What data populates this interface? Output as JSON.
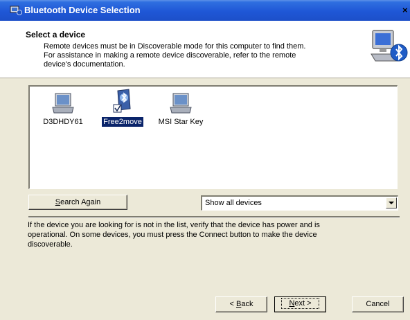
{
  "window": {
    "title": "Bluetooth Device Selection",
    "close_glyph": "×"
  },
  "header": {
    "title": "Select a device",
    "description_lines": [
      "Remote devices must be in Discoverable mode for this computer to find them.",
      "For assistance in making a remote device discoverable, refer to the remote",
      "device's documentation."
    ],
    "icon": "bluetooth-computer-icon"
  },
  "devices": [
    {
      "label": "D3DHDY61",
      "icon": "laptop-icon",
      "selected": false
    },
    {
      "label": "Free2move",
      "icon": "bluetooth-device-icon",
      "selected": true
    },
    {
      "label": "MSI Star Key",
      "icon": "laptop-icon",
      "selected": false
    }
  ],
  "search_button": {
    "label_prefix": "",
    "mnemonic": "S",
    "label_rest": "earch Again"
  },
  "filter": {
    "selected": "Show all devices"
  },
  "info_lines": [
    "If the device you are looking for is not in the list, verify that the device has power and is",
    "operational. On some devices, you must press the Connect button to make the device",
    "discoverable."
  ],
  "buttons": {
    "back": {
      "prefix": "< ",
      "mnemonic": "B",
      "rest": "ack"
    },
    "next": {
      "prefix": "",
      "mnemonic": "N",
      "rest": "ext >"
    },
    "cancel": "Cancel"
  },
  "colors": {
    "title_bar": "#1f57d6",
    "selection": "#0a246a",
    "dialog_bg": "#ece9d8"
  }
}
